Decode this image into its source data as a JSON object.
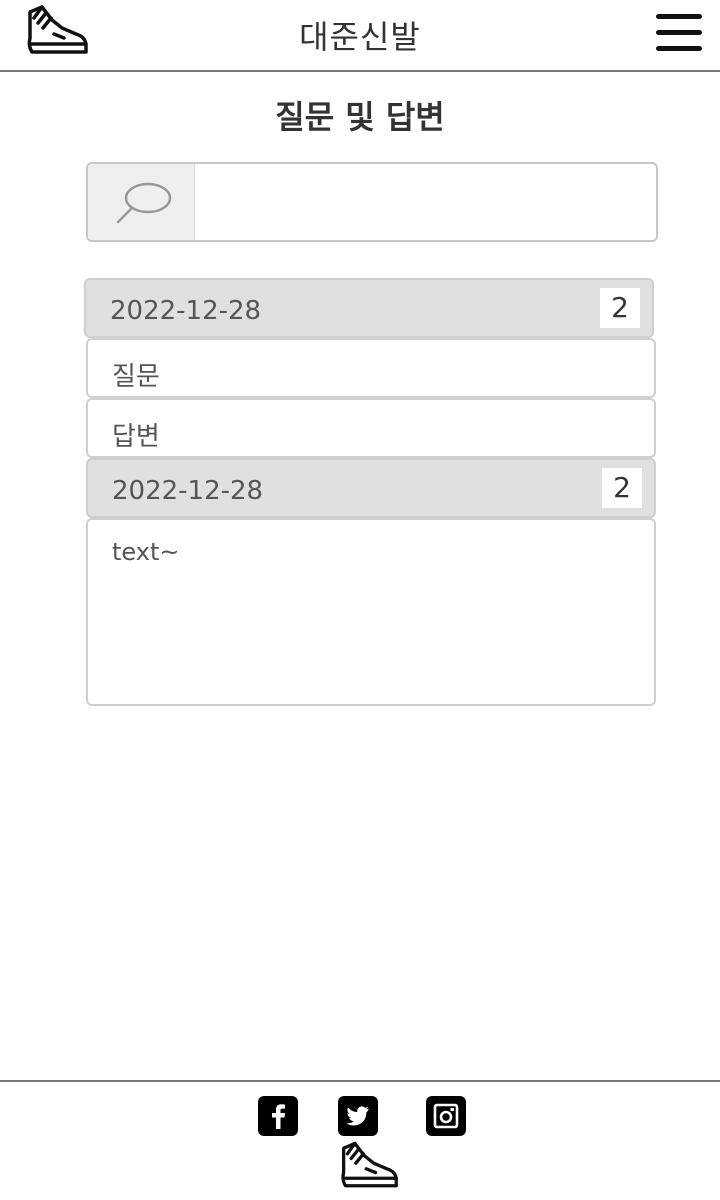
{
  "header": {
    "site_title": "대준신발",
    "logo_icon": "sneaker-icon",
    "menu_icon": "hamburger-menu-icon"
  },
  "page": {
    "title": "질문 및 답변"
  },
  "search": {
    "icon": "search-icon",
    "value": "",
    "placeholder": ""
  },
  "qa_items": [
    {
      "date": "2022-12-28",
      "count": "2",
      "question_label": "질문",
      "answer_label": "답변"
    },
    {
      "date": "2022-12-28",
      "count": "2",
      "body_text": "text~"
    }
  ],
  "footer": {
    "social_icons": [
      "facebook-icon",
      "twitter-icon",
      "instagram-icon"
    ],
    "logo_icon": "sneaker-icon"
  }
}
